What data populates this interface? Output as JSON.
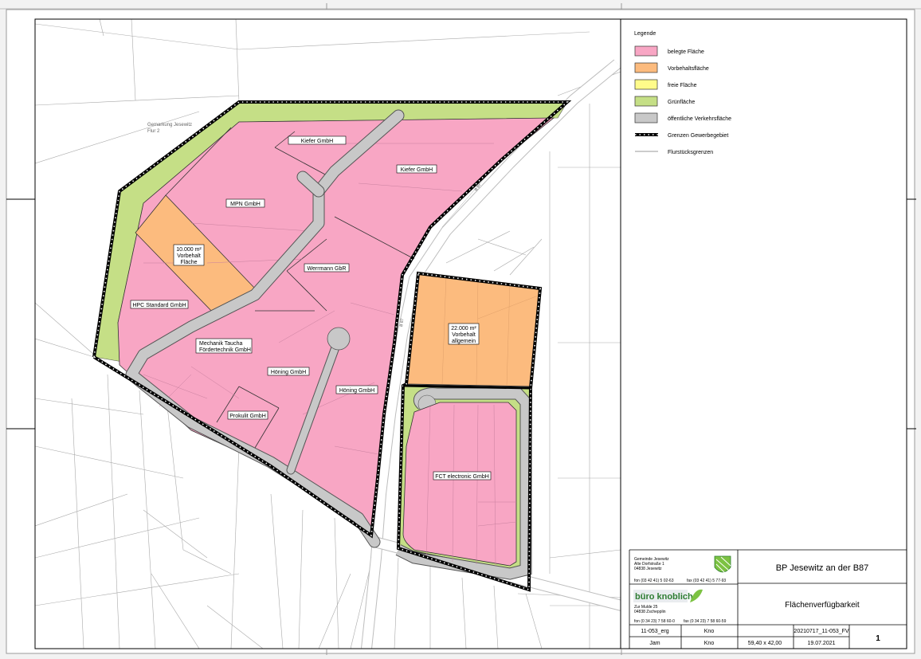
{
  "legend": {
    "title": "Legende",
    "items": [
      {
        "label": "belegte Fläche",
        "color": "#f8a6c4"
      },
      {
        "label": "Vorbehaltsfläche",
        "color": "#fcbb7e"
      },
      {
        "label": "freie Fläche",
        "color": "#fffb8a"
      },
      {
        "label": "Grünfläche",
        "color": "#c5df86"
      },
      {
        "label": "öffentliche Verkehrsfläche",
        "color": "#c8c8c8"
      },
      {
        "label": "Grenzen Gewerbegebiet",
        "color": "#000000"
      },
      {
        "label": "Flurstücksgrenzen",
        "color": "#9a9a9a"
      }
    ]
  },
  "map": {
    "gemarkung_line1": "Gemarkung Jesewitz",
    "gemarkung_line2": "Flur 2",
    "parcels": {
      "kiefer_small": "Kiefer GmbH",
      "kiefer_large": "Kiefer GmbH",
      "mpn": "MPN GmbH",
      "reserve1_line1": "10.000 m²",
      "reserve1_line2": "Vorbehalt",
      "reserve1_line3": "Fläche",
      "hpc": "HPC Standard GmbH",
      "wermann": "Werrmann GbR",
      "mechanik_line1": "Mechanik Taucha",
      "mechanik_line2": "Fördertechnik GmbH",
      "hoening1": "Höning GmbH",
      "hoening2": "Höning GmbH",
      "prokulit": "Prokulit GmbH",
      "reserve2_line1": "22.000 m²",
      "reserve2_line2": "Vorbehalt",
      "reserve2_line3": "allgemein",
      "fct": "FCT electronic GmbH"
    },
    "street_b87": "B 87"
  },
  "title_block": {
    "client_line1": "Gemeinde Jesewitz",
    "client_line2": "Alte Dorfstraße 1",
    "client_line3": "04838 Jesewitz",
    "client_fon": "fon (03 42 41) 5 02-63",
    "client_fax": "fax (03 42 41) 5 77-93",
    "office_logo": "büro knoblich",
    "office_line1": "Zur Mulde 25",
    "office_line2": "04838 Zschepplin",
    "office_fon": "fon (0 34 23) 7 58 60-0",
    "office_fax": "fax (0 34 23) 7 58 60-59",
    "project_title": "BP Jesewitz an der B87",
    "plan_title": "Flächenverfügbarkeit",
    "project_no": "11-053_erg",
    "drawn_by": "Kno",
    "checked_by_name": "Jam",
    "checked_by": "Kno",
    "format": "59,40 x 42,00",
    "file_name": "20210717_11-053_FV",
    "date": "19.07.2021",
    "sheet_no": "1"
  }
}
